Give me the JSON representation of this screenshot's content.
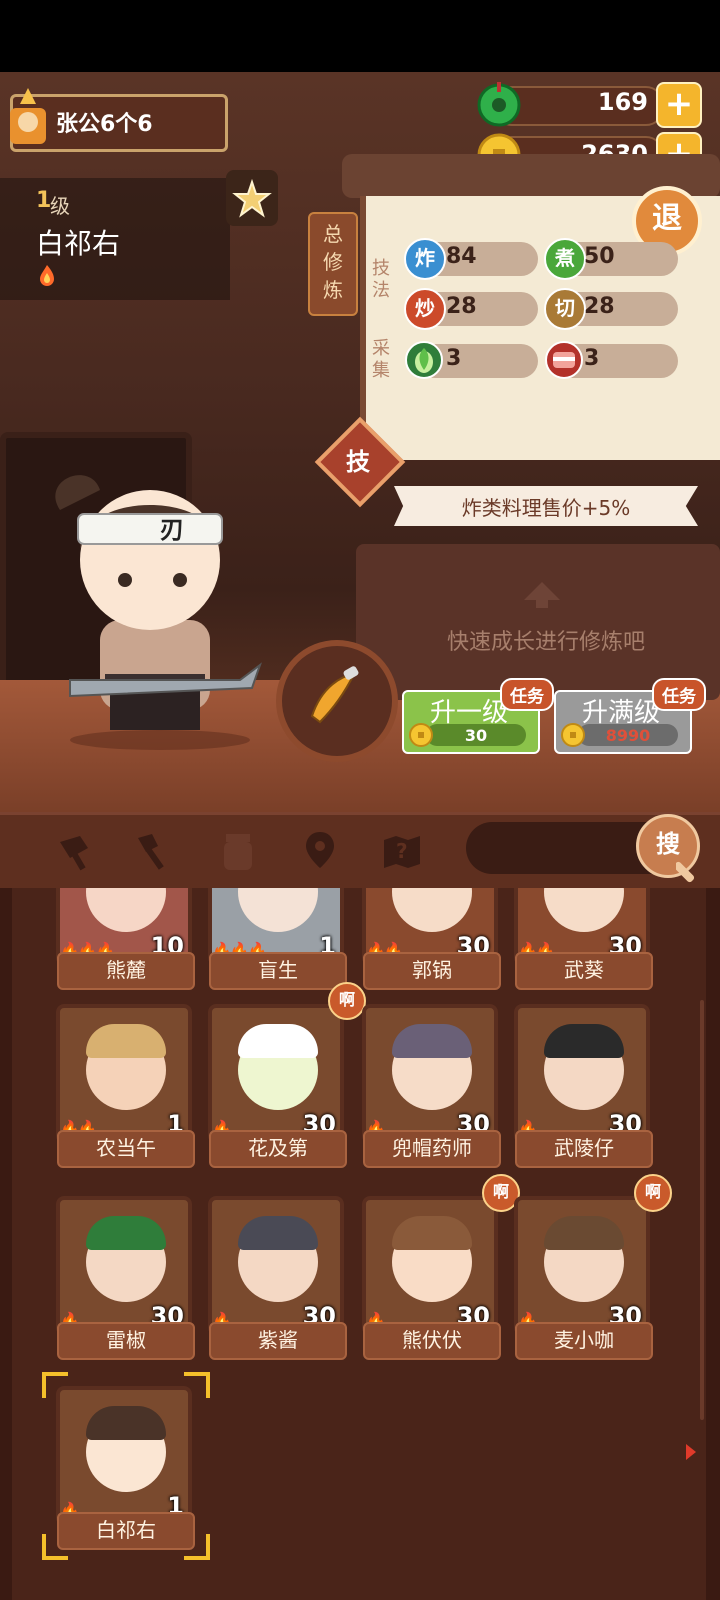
{
  "player": {
    "name": "张公6个6"
  },
  "currencies": {
    "jade": "169",
    "coins": "2630"
  },
  "character": {
    "level_num": "1",
    "level_unit": "级",
    "name": "白祁右"
  },
  "side_tab": [
    "总",
    "修",
    "炼"
  ],
  "exit_label": "退",
  "stats": {
    "skills_label": [
      "技",
      "法"
    ],
    "gather_label": [
      "采",
      "集"
    ],
    "fry": {
      "icon": "炸",
      "value": "84"
    },
    "boil": {
      "icon": "煮",
      "value": "50"
    },
    "stirfry": {
      "icon": "炒",
      "value": "28"
    },
    "cut": {
      "icon": "切",
      "value": "28"
    },
    "veg": {
      "value": "3"
    },
    "meat": {
      "value": "3"
    }
  },
  "skill_button": "技",
  "bonus": "炸类料理售价+5%",
  "hint": "快速成长进行修炼吧",
  "actions": {
    "level_up": {
      "label": "升一级",
      "cost": "30",
      "task": "任务"
    },
    "max_level": {
      "label": "升满级",
      "cost": "8990",
      "task": "任务"
    }
  },
  "search_label": "搜",
  "roster_badge": "啊",
  "roster": [
    {
      "name": "熊麓",
      "level": "10"
    },
    {
      "name": "盲生",
      "level": "1"
    },
    {
      "name": "郭锅",
      "level": "30"
    },
    {
      "name": "武葵",
      "level": "30"
    },
    {
      "name": "农当午",
      "level": "1"
    },
    {
      "name": "花及第",
      "level": "30"
    },
    {
      "name": "兜帽药师",
      "level": "30"
    },
    {
      "name": "武陵仔",
      "level": "30"
    },
    {
      "name": "雷椒",
      "level": "30"
    },
    {
      "name": "紫酱",
      "level": "30"
    },
    {
      "name": "熊伏伏",
      "level": "30"
    },
    {
      "name": "麦小咖",
      "level": "30"
    },
    {
      "name": "白祁右",
      "level": "1"
    }
  ],
  "colors": {
    "accent": "#f4b52c",
    "panel": "#f4ead4",
    "wood": "#5e2f1f"
  }
}
